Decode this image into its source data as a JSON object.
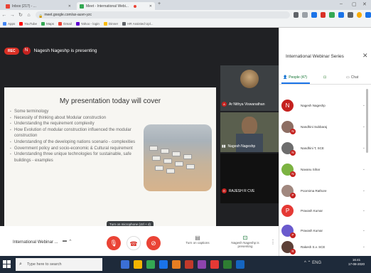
{
  "browser": {
    "tabs": [
      {
        "label": "Inbox (217) - ...",
        "favicon_color": "#ea4335",
        "active": false
      },
      {
        "label": "Meet - International Webi...",
        "favicon_color": "#34a853",
        "active": true
      }
    ],
    "new_tab": "+",
    "address": "meet.google.com/ax-auvn-yzc",
    "bookmarks": [
      {
        "label": "Apps",
        "color": "#4285f4"
      },
      {
        "label": "YouTube",
        "color": "#ff0000"
      },
      {
        "label": "Maps",
        "color": "#34a853"
      },
      {
        "label": "Gmail",
        "color": "#ea4335"
      },
      {
        "label": "Yahoo - login",
        "color": "#6001d2"
      },
      {
        "label": "Dinner",
        "color": "#fbbc05"
      },
      {
        "label": "HR Assisted Upl...",
        "color": "#5f6368"
      }
    ]
  },
  "meet": {
    "rec_label": "REC",
    "presenter_initial": "N",
    "presenting_text": "Nagesh Nageshp is presenting",
    "slide": {
      "title": "My presentation today will cover",
      "bullets": [
        "Some terminology",
        "Necessity of thinking about Modular construction",
        "Understanding the requirement complexity",
        "How Evolution of modular construction influenced the modular construction",
        "Understanding of the developing nations scenario - complexities",
        "Government policy and socio-economic & Cultural requirement",
        "Understanding three unique technologies for sustainable, safe buildings - examples"
      ]
    },
    "tiles": [
      {
        "name": "Ar Nithya Viswanathan",
        "initial": "A"
      },
      {
        "name": "Nagesh Nageshp",
        "initial": "N"
      },
      {
        "name": "RAJESH R CVE",
        "initial": "R"
      }
    ],
    "tooltip": "Turn on microphone (ctrl + d)",
    "meeting_title": "International Webinar ...",
    "captions_label": "Turn on captions",
    "present_label": "Nagesh Nageshp is presenting",
    "colors": {
      "end_call": "#d93025",
      "muted": "#ea4335"
    }
  },
  "panel": {
    "title": "International Webinar Series",
    "tabs": {
      "people": "People (47)",
      "chat": "Chat"
    },
    "participants": [
      {
        "name": "Nagesh Nageshp",
        "initial": "N",
        "color": "#c5221f"
      },
      {
        "name": "Nandhini Subbaraj",
        "initial": "N",
        "color": "#8d6e63"
      },
      {
        "name": "Nandhini T, SCE",
        "initial": "N",
        "color": "#6d6d6d"
      },
      {
        "name": "Navanu Sihar",
        "initial": "N",
        "color": "#7cb342"
      },
      {
        "name": "Poornima Rathore",
        "initial": "P",
        "color": "#a1887f"
      },
      {
        "name": "Pravash Kumar",
        "initial": "P",
        "color": "#e53935"
      },
      {
        "name": "Pravash Kumar",
        "initial": "P",
        "color": "#6a5acd"
      },
      {
        "name": "Rakesh S.v. SCE",
        "initial": "R",
        "color": "#5d4037"
      }
    ]
  },
  "taskbar": {
    "search_placeholder": "Type here to search",
    "time": "16:41",
    "date": "17-08-2020",
    "tray": "^ ⌃ ENG",
    "apps": [
      "#3b6fd6",
      "#f4b400",
      "#34a853",
      "#1a73e8",
      "#e67e22",
      "#c0392b",
      "#8e44ad",
      "#e53935",
      "#2e7d32",
      "#1565c0"
    ]
  }
}
